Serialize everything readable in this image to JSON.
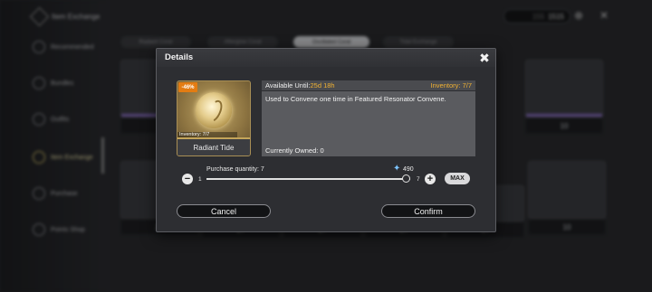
{
  "background": {
    "header_title": "Item Exchange",
    "currency_value": "1515",
    "currency_dim": "155",
    "sidebar_items": [
      {
        "label": "Item Exchange"
      },
      {
        "label": "Recommended"
      },
      {
        "label": "Bundles"
      },
      {
        "label": "Outfits"
      },
      {
        "label": "Item Exchange"
      },
      {
        "label": "Purchase"
      },
      {
        "label": "Points Shop"
      }
    ],
    "tabs": [
      "Radiant Coral",
      "Afterglow Coral",
      "Oscillated Coral",
      "Tidal Exchange"
    ],
    "costs": [
      "7",
      "10",
      "27",
      "27",
      "27",
      "27",
      "27",
      "10"
    ]
  },
  "dialog": {
    "title": "Details",
    "close_icon": "close-icon",
    "item": {
      "discount": "-46%",
      "inventory": "Inventory: 7/7",
      "name": "Radiant Tide"
    },
    "available_label": "Available Until:",
    "available_value": "25d 18h",
    "inventory_label": "Inventory: 7/7",
    "description": "Used to Convene one time in Featured Resonator Convene.",
    "owned": "Currently Owned: 0",
    "purchase_label": "Purchase quantity: 7",
    "cost": "490",
    "slider": {
      "min": "1",
      "max": "7",
      "value": 7
    },
    "max_label": "MAX",
    "cancel_label": "Cancel",
    "confirm_label": "Confirm"
  },
  "colors": {
    "accent": "#f1b233",
    "discount": "#e37c12",
    "currency": "#7cc4ff"
  }
}
